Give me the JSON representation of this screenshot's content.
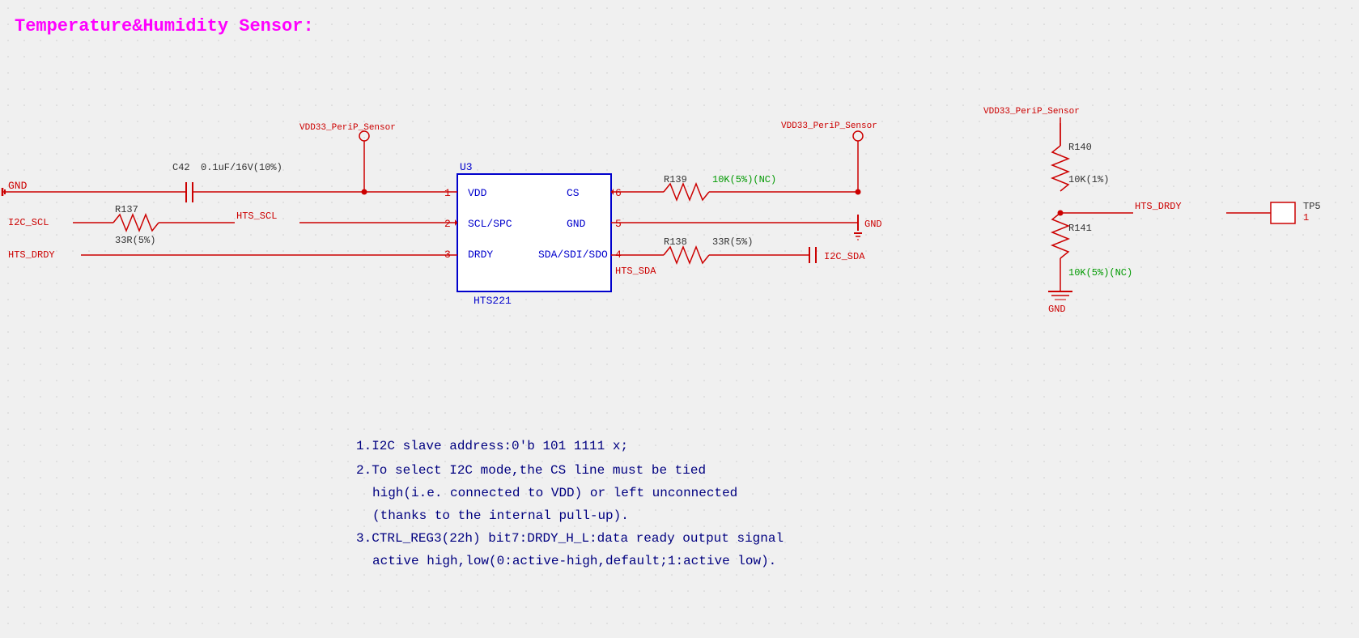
{
  "title": "Temperature&Humidity Sensor:",
  "schematic": {
    "title": "Temperature&Humidity  Sensor:",
    "notes": [
      "1.I2C slave address:0'b 101 1111 x;",
      "2.To select I2C mode,the CS line must be tied",
      "   high(i.e. connected to VDD) or left unconnected",
      "   (thanks to the internal pull-up).",
      "3.CTRL_REG3(22h) bit7:DRDY_H_L:data ready output signal",
      "  active  high,low(0:active-high,default;1:active  low)."
    ],
    "ic": {
      "name": "U3",
      "part": "HTS221",
      "pins_left": [
        "1 VDD",
        "2 SCL/SPC",
        "3 DRDY"
      ],
      "pins_right": [
        "6 CS",
        "5 GND",
        "4 SDA/SDI/SDO"
      ]
    },
    "nets": {
      "power": "VDD33_PeriP_Sensor",
      "gnd": "GND",
      "i2c_scl": "I2C_SCL",
      "i2c_sda": "I2C_SDA",
      "hts_scl": "HTS_SCL",
      "hts_sda": "HTS_SDA",
      "hts_drdy": "HTS_DRDY"
    },
    "components": {
      "C42": "C42",
      "C42_val": "0.1uF/16V(10%)",
      "R137": "R137",
      "R137_val": "33R(5%)",
      "R138": "R138",
      "R138_val": "33R(5%)",
      "R139": "R139",
      "R139_val": "10K(5%)(NC)",
      "R140": "R140",
      "R140_val": "10K(1%)",
      "R141": "R141",
      "R141_val": "10K(5%)(NC)",
      "TP5": "TP5",
      "TP5_num": "1"
    }
  }
}
